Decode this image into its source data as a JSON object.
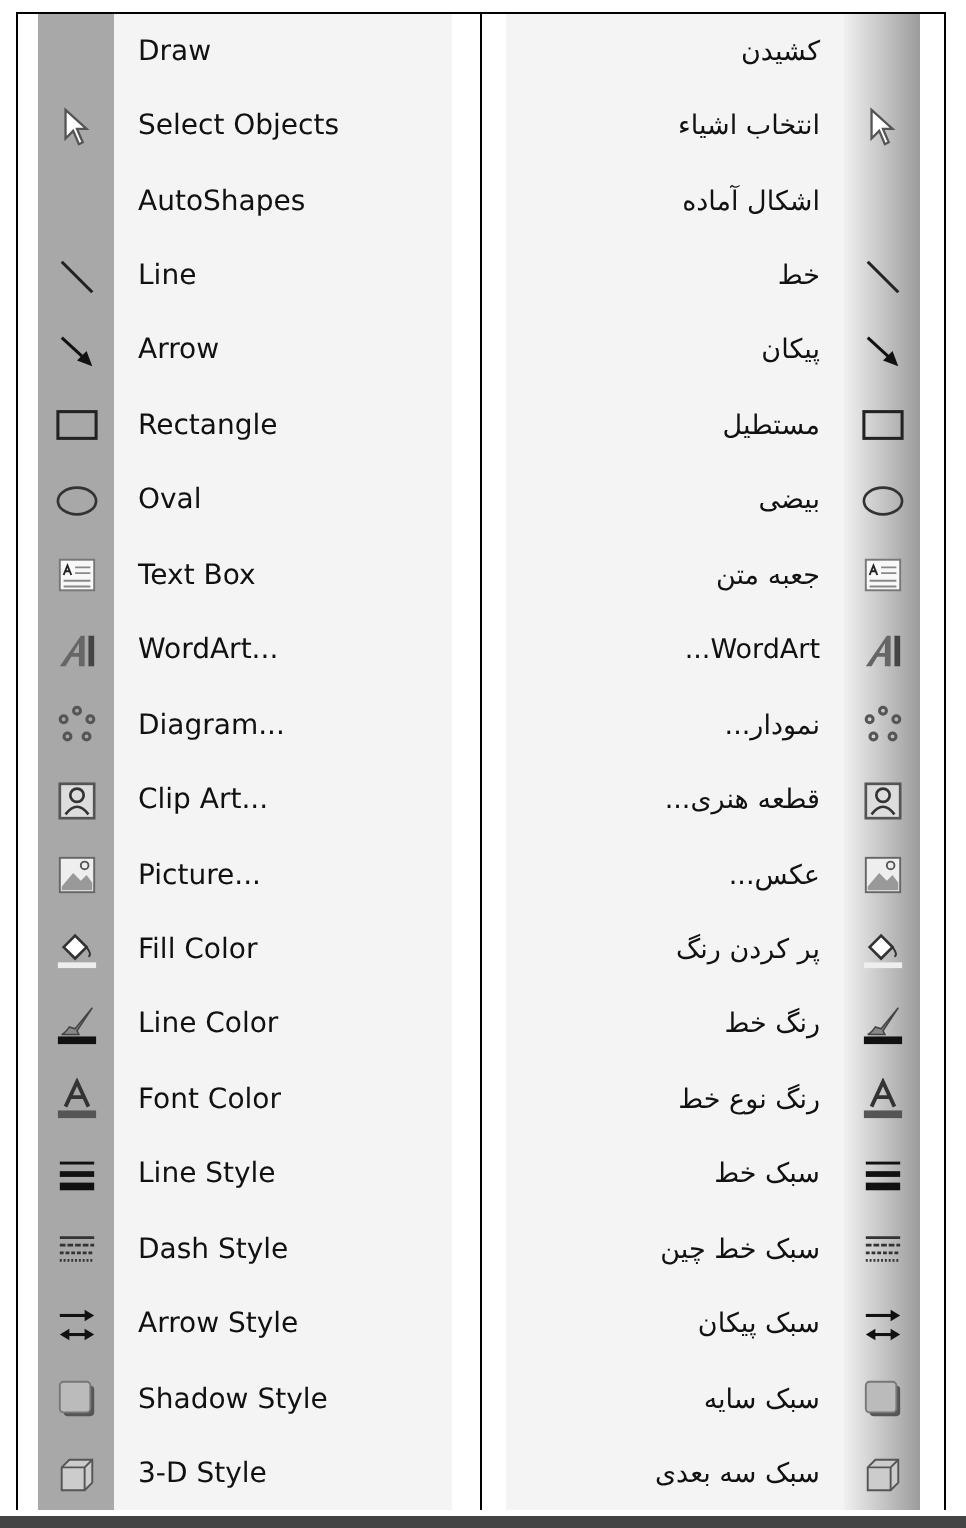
{
  "english_menu": {
    "items": [
      {
        "kind": "plain",
        "label": "Draw"
      },
      {
        "kind": "pointer",
        "label": "Select Objects"
      },
      {
        "kind": "plain",
        "label": "AutoShapes"
      },
      {
        "kind": "line",
        "label": "Line"
      },
      {
        "kind": "arrow",
        "label": "Arrow"
      },
      {
        "kind": "rectangle",
        "label": "Rectangle"
      },
      {
        "kind": "oval",
        "label": "Oval"
      },
      {
        "kind": "textbox",
        "label": "Text Box"
      },
      {
        "kind": "wordart",
        "label": "WordArt..."
      },
      {
        "kind": "diagram",
        "label": "Diagram..."
      },
      {
        "kind": "clipart",
        "label": "Clip Art..."
      },
      {
        "kind": "picture",
        "label": "Picture..."
      },
      {
        "kind": "fill",
        "label": "Fill Color"
      },
      {
        "kind": "linecolor",
        "label": "Line Color"
      },
      {
        "kind": "fontcolor",
        "label": "Font Color"
      },
      {
        "kind": "linestyle",
        "label": "Line Style"
      },
      {
        "kind": "dash",
        "label": "Dash Style"
      },
      {
        "kind": "arrowstyle",
        "label": "Arrow Style"
      },
      {
        "kind": "shadow",
        "label": "Shadow Style"
      },
      {
        "kind": "cube",
        "label": "3-D Style"
      }
    ]
  },
  "persian_menu": {
    "items": [
      {
        "kind": "plain",
        "label": "کشیدن"
      },
      {
        "kind": "pointer",
        "label": "انتخاب اشیاء"
      },
      {
        "kind": "plain",
        "label": "اشکال آماده"
      },
      {
        "kind": "line",
        "label": "خط"
      },
      {
        "kind": "arrow",
        "label": "پیکان"
      },
      {
        "kind": "rectangle",
        "label": "مستطیل"
      },
      {
        "kind": "oval",
        "label": "بیضی"
      },
      {
        "kind": "textbox",
        "label": "جعبه متن"
      },
      {
        "kind": "wordart",
        "label": "...WordArt"
      },
      {
        "kind": "diagram",
        "label": "نمودار..."
      },
      {
        "kind": "clipart",
        "label": "قطعه هنری..."
      },
      {
        "kind": "picture",
        "label": "عکس..."
      },
      {
        "kind": "fill",
        "label": "پر کردن رنگ"
      },
      {
        "kind": "linecolor",
        "label": "رنگ خط"
      },
      {
        "kind": "fontcolor",
        "label": "رنگ نوع خط"
      },
      {
        "kind": "linestyle",
        "label": "سبک خط"
      },
      {
        "kind": "dash",
        "label": "سبک خط چین"
      },
      {
        "kind": "arrowstyle",
        "label": "سبک پیکان"
      },
      {
        "kind": "shadow",
        "label": "سبک سایه"
      },
      {
        "kind": "cube",
        "label": "سبک سه بعدی"
      }
    ]
  }
}
